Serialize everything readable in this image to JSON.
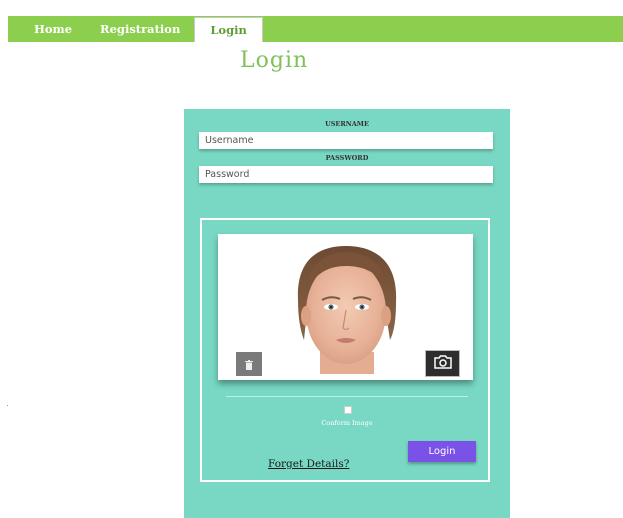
{
  "nav": {
    "items": [
      {
        "label": "Home"
      },
      {
        "label": "Registration"
      },
      {
        "label": "Login"
      }
    ],
    "active_index": 2
  },
  "page_title": "Login",
  "form": {
    "username_label": "USERNAME",
    "username_placeholder": "Username",
    "username_value": "",
    "password_label": "PASSWORD",
    "password_placeholder": "Password",
    "password_value": ""
  },
  "capture": {
    "trash_icon": "trash-icon",
    "camera_icon": "camera-icon",
    "confirm_label": "Conform Image",
    "confirm_checked": false
  },
  "actions": {
    "forget_label": "Forget Details?",
    "login_label": "Login"
  },
  "colors": {
    "nav_bg": "#8ccf4f",
    "panel_bg": "#78d8c3",
    "title": "#7fc15a",
    "login_button": "#7b52e8"
  }
}
